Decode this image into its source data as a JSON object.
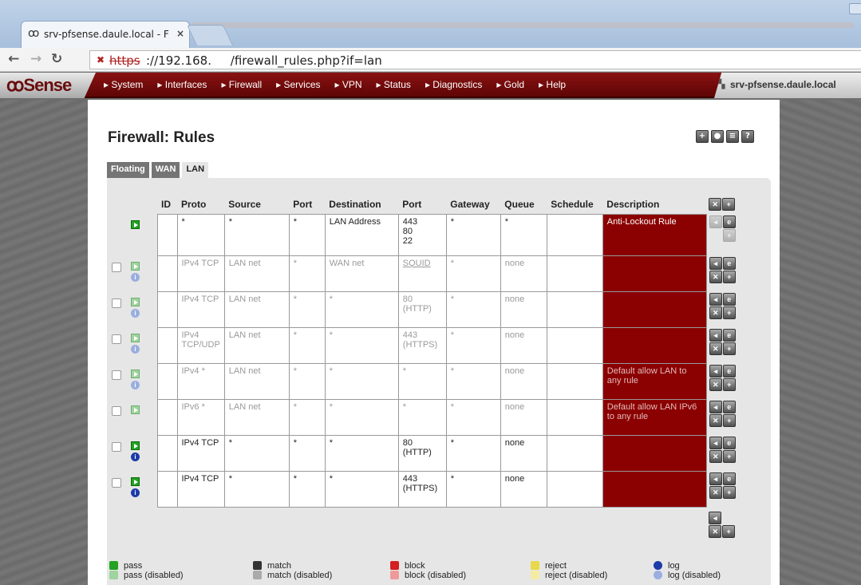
{
  "browser": {
    "tab_title": "srv-pfsense.daule.local - F",
    "tab_close": "×",
    "tab_favicon": "pfsense-icon",
    "url_protocol": "https",
    "url_rest": "://192.168.     /firewall_rules.php?if=lan"
  },
  "nav": {
    "logo": "Sense",
    "logo_mark": "ꝏ",
    "menu": [
      "▸ System",
      "▸ Interfaces",
      "▸ Firewall",
      "▸ Services",
      "▸ VPN",
      "▸ Status",
      "▸ Diagnostics",
      "▸ Gold",
      "▸ Help"
    ],
    "hostname": "srv-pfsense.daule.local"
  },
  "page": {
    "title": "Firewall: Rules",
    "tabs": [
      "Floating",
      "WAN",
      "LAN"
    ],
    "active_tab": "LAN"
  },
  "table": {
    "headers": {
      "id": "ID",
      "proto": "Proto",
      "source": "Source",
      "port": "Port",
      "destination": "Destination",
      "dport": "Port",
      "gateway": "Gateway",
      "queue": "Queue",
      "schedule": "Schedule",
      "description": "Description"
    },
    "rows": [
      {
        "id": "",
        "proto": "*",
        "source": "*",
        "port": "*",
        "destination": "LAN Address",
        "dport": "443\n80\n22",
        "gateway": "*",
        "queue": "*",
        "schedule": "",
        "description": "Anti-Lockout Rule"
      },
      {
        "id": "",
        "proto": "IPv4 TCP",
        "source": "LAN net",
        "port": "*",
        "destination": "WAN net",
        "dport": "SQUID",
        "gateway": "*",
        "queue": "none",
        "schedule": "",
        "description": ""
      },
      {
        "id": "",
        "proto": "IPv4 TCP",
        "source": "LAN net",
        "port": "*",
        "destination": "*",
        "dport": "80\n(HTTP)",
        "gateway": "*",
        "queue": "none",
        "schedule": "",
        "description": ""
      },
      {
        "id": "",
        "proto": "IPv4\nTCP/UDP",
        "source": "LAN net",
        "port": "*",
        "destination": "*",
        "dport": "443\n(HTTPS)",
        "gateway": "*",
        "queue": "none",
        "schedule": "",
        "description": ""
      },
      {
        "id": "",
        "proto": "IPv4 *",
        "source": "LAN net",
        "port": "*",
        "destination": "*",
        "dport": "*",
        "gateway": "*",
        "queue": "none",
        "schedule": "",
        "description": "Default allow LAN to any rule"
      },
      {
        "id": "",
        "proto": "IPv6 *",
        "source": "LAN net",
        "port": "*",
        "destination": "*",
        "dport": "*",
        "gateway": "*",
        "queue": "none",
        "schedule": "",
        "description": "Default allow LAN IPv6 to any rule"
      },
      {
        "id": "",
        "proto": "IPv4 TCP",
        "source": "*",
        "port": "*",
        "destination": "*",
        "dport": "80\n(HTTP)",
        "gateway": "*",
        "queue": "none",
        "schedule": "",
        "description": ""
      },
      {
        "id": "",
        "proto": "IPv4 TCP",
        "source": "*",
        "port": "*",
        "destination": "*",
        "dport": "443\n(HTTPS)",
        "gateway": "*",
        "queue": "none",
        "schedule": "",
        "description": ""
      }
    ]
  },
  "legend": {
    "pass": "pass",
    "pass_disabled": "pass (disabled)",
    "match": "match",
    "match_disabled": "match (disabled)",
    "block": "block",
    "block_disabled": "block (disabled)",
    "reject": "reject",
    "reject_disabled": "reject (disabled)",
    "log": "log",
    "log_disabled": "log (disabled)"
  },
  "colors": {
    "brand": "#8b0000",
    "pass": "#22a322",
    "block": "#d42020",
    "reject": "#e8d84a",
    "log": "#1c3aa8"
  }
}
